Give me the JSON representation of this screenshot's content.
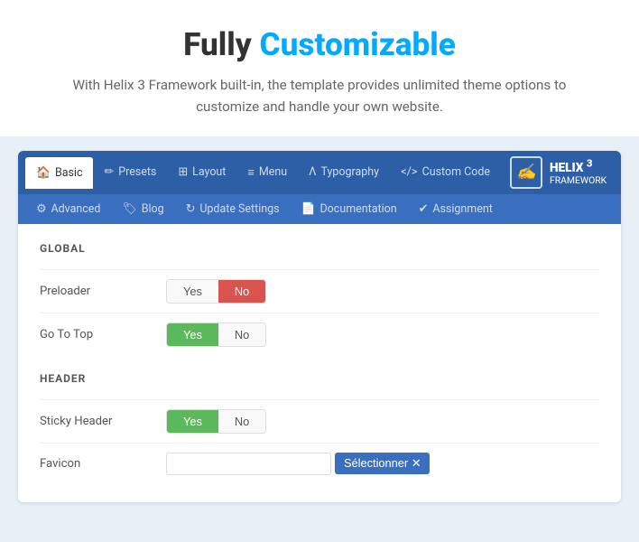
{
  "hero": {
    "title_prefix": "Fully ",
    "title_highlight": "Customizable",
    "subtitle": "With Helix 3 Framework built-in, the template provides unlimited theme options to customize and handle your own website."
  },
  "nav_top": {
    "tabs": [
      {
        "id": "basic",
        "icon": "🏠",
        "label": "Basic",
        "active": true
      },
      {
        "id": "presets",
        "icon": "✏",
        "label": "Presets",
        "active": false
      },
      {
        "id": "layout",
        "icon": "⊞",
        "label": "Layout",
        "active": false
      },
      {
        "id": "menu",
        "icon": "≡",
        "label": "Menu",
        "active": false
      },
      {
        "id": "typography",
        "icon": "Λ",
        "label": "Typography",
        "active": false
      },
      {
        "id": "custom-code",
        "icon": "</>",
        "label": "Custom Code",
        "active": false
      }
    ]
  },
  "logo": {
    "icon_char": "✍",
    "name": "HELIX",
    "version": "3",
    "subtitle": "FRAMEWORK"
  },
  "nav_bottom": {
    "tabs": [
      {
        "id": "advanced",
        "icon": "⚙",
        "label": "Advanced"
      },
      {
        "id": "blog",
        "icon": "🏷",
        "label": "Blog"
      },
      {
        "id": "update-settings",
        "icon": "↻",
        "label": "Update Settings"
      },
      {
        "id": "documentation",
        "icon": "📄",
        "label": "Documentation"
      },
      {
        "id": "assignment",
        "icon": "✔",
        "label": "Assignment"
      }
    ]
  },
  "global_section": {
    "label": "GLOBAL",
    "fields": [
      {
        "id": "preloader",
        "label": "Preloader",
        "yes_active": false,
        "no_active": true
      },
      {
        "id": "go-to-top",
        "label": "Go To Top",
        "yes_active": true,
        "no_active": false
      }
    ]
  },
  "header_section": {
    "label": "HEADER",
    "fields": [
      {
        "id": "sticky-header",
        "label": "Sticky Header",
        "yes_active": true,
        "no_active": false
      },
      {
        "id": "favicon",
        "label": "Favicon",
        "select_placeholder": "",
        "select_btn": "Sélectionner"
      }
    ]
  }
}
